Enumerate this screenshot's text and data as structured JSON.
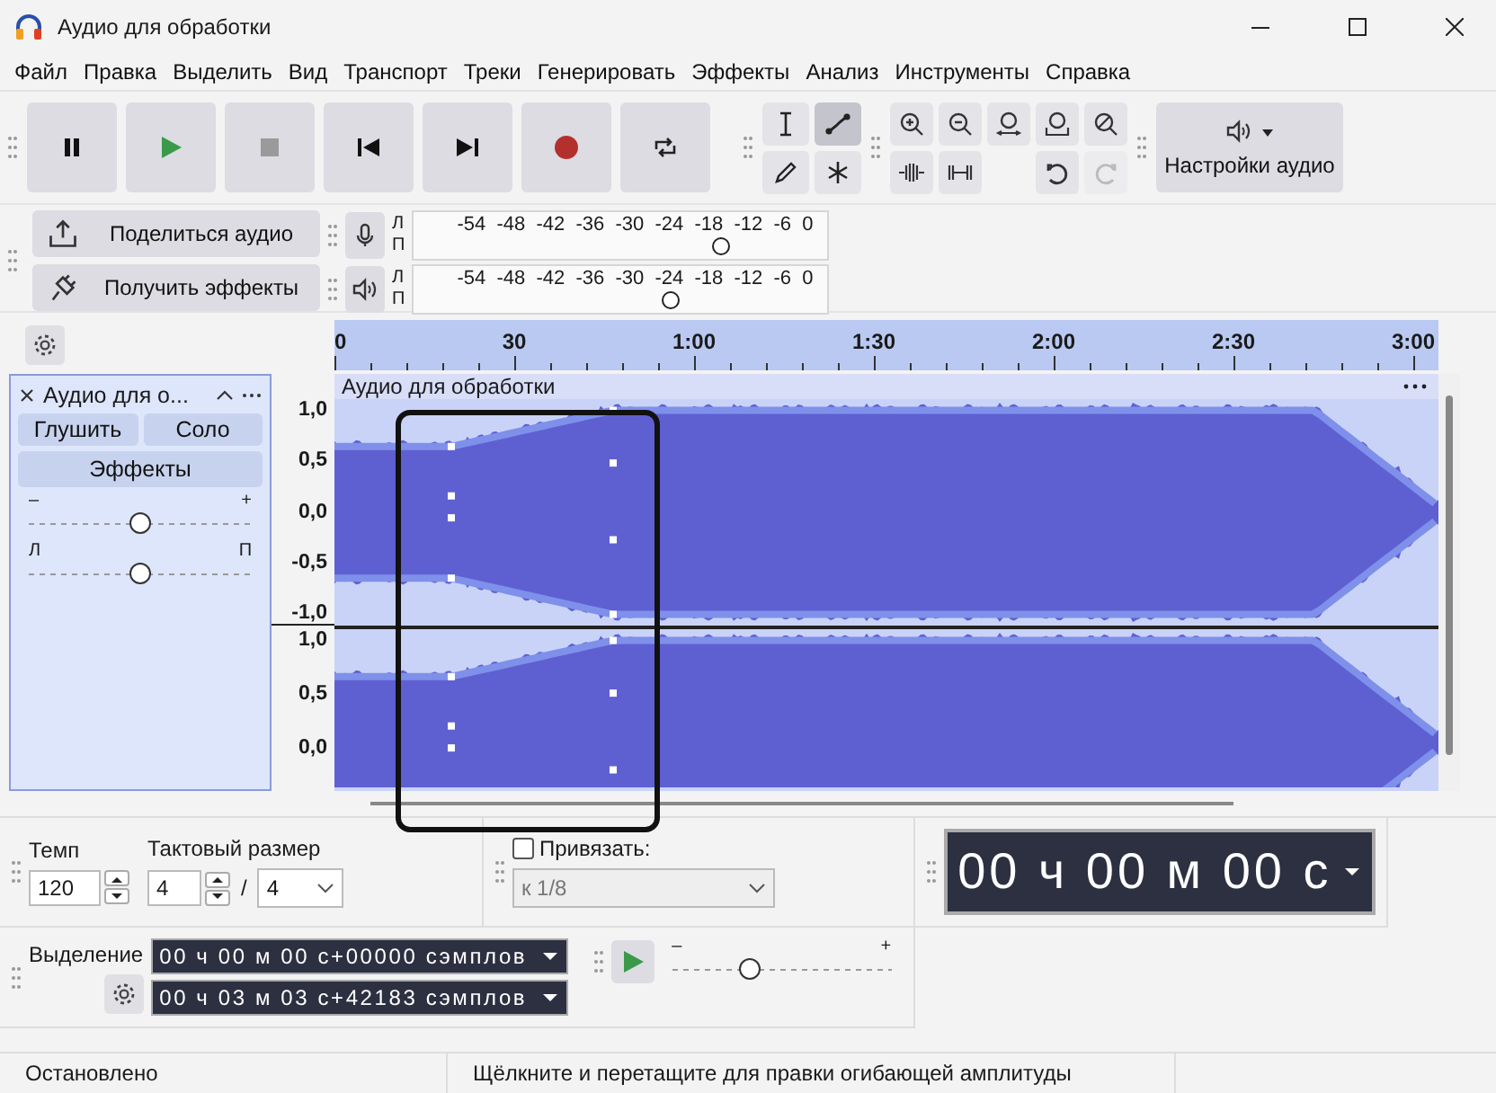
{
  "window": {
    "title": "Аудио для обработки"
  },
  "menu": [
    "Файл",
    "Правка",
    "Выделить",
    "Вид",
    "Транспорт",
    "Треки",
    "Генерировать",
    "Эффекты",
    "Анализ",
    "Инструменты",
    "Справка"
  ],
  "tools": [
    {
      "kind": "select",
      "selected": false
    },
    {
      "kind": "envelope",
      "selected": true
    },
    {
      "kind": "draw",
      "selected": false
    },
    {
      "kind": "multi",
      "selected": false
    }
  ],
  "history": [
    {
      "kind": "undo",
      "disabled": false
    },
    {
      "kind": "redo",
      "disabled": true
    }
  ],
  "audio_settings": {
    "label": "Настройки аудио"
  },
  "share": {
    "label": "Поделиться аудио"
  },
  "get_effects": {
    "label": "Получить эффекты"
  },
  "meters": [
    {
      "kind": "record",
      "channels": [
        "Л",
        "П"
      ],
      "ticks": [
        "-54",
        "-48",
        "-42",
        "-36",
        "-30",
        "-24",
        "-18",
        "-12",
        "-6",
        "0"
      ],
      "level": 0.74
    },
    {
      "kind": "playback",
      "channels": [
        "Л",
        "П"
      ],
      "ticks": [
        "-54",
        "-48",
        "-42",
        "-36",
        "-30",
        "-24",
        "-18",
        "-12",
        "-6",
        "0"
      ],
      "level": 0.6
    }
  ],
  "ruler": {
    "labels": [
      "0",
      "30",
      "1:00",
      "1:30",
      "2:00",
      "2:30",
      "3:00"
    ]
  },
  "track": {
    "name": "Аудио для о...",
    "buttons": [
      "Глушить",
      "Соло"
    ],
    "effects": "Эффекты",
    "gain": {
      "min": "–",
      "max": "+",
      "level": 0.5
    },
    "pan": {
      "min": "Л",
      "max": "П",
      "level": 0.5
    },
    "clip_title": "Аудио для обработки",
    "scales": [
      [
        "1,0",
        "0,5",
        "0,0",
        "-0,5",
        "-1,0"
      ],
      [
        "1,0",
        "0,5",
        "0,0"
      ]
    ]
  },
  "tempo": {
    "label": "Темп",
    "value": "120"
  },
  "time_signature": {
    "label": "Тактовый размер",
    "upper": "4",
    "separator": "/",
    "lower": "4"
  },
  "snap": {
    "label": "Привязать:",
    "checked": false,
    "value": "к 1/8",
    "disabled": true
  },
  "time_display": "00 ч 00 м 00 с",
  "selection": {
    "label": "Выделение",
    "start": "00 ч 00 м 00 с+00000 сэмплов",
    "end": "00 ч 03 м 03 с+42183 сэмплов"
  },
  "play_speed": {
    "min": "–",
    "max": "+",
    "level": 0.34
  },
  "status_bar": [
    "Остановлено",
    "Щёлкните и перетащите для правки огибающей амплитуды"
  ]
}
